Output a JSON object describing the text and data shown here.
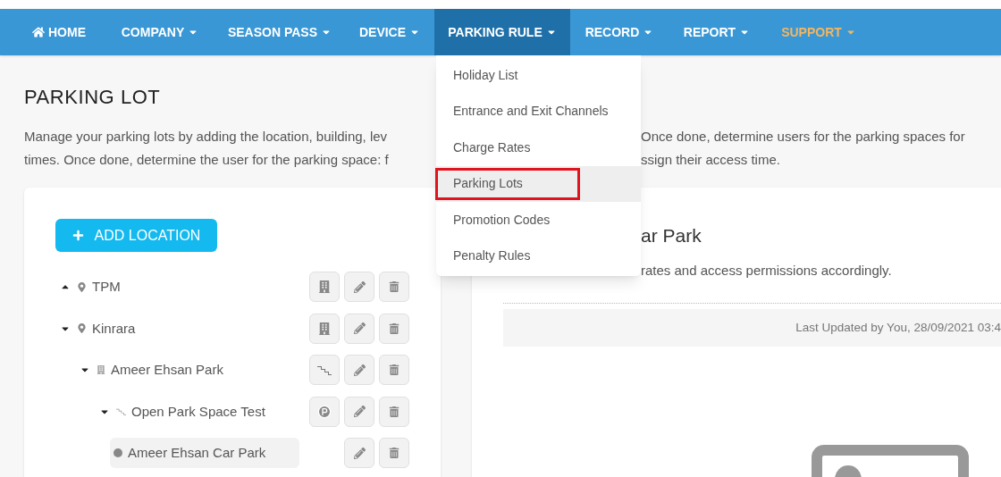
{
  "nav": [
    {
      "label": "HOME",
      "kind": "home",
      "selected": false,
      "highlight": false
    },
    {
      "label": "COMPANY",
      "kind": "menu",
      "selected": false,
      "highlight": false
    },
    {
      "label": "SEASON PASS",
      "kind": "menu",
      "selected": false,
      "highlight": false
    },
    {
      "label": "DEVICE",
      "kind": "menu",
      "selected": false,
      "highlight": false
    },
    {
      "label": "PARKING RULE",
      "kind": "menu",
      "selected": true,
      "highlight": false
    },
    {
      "label": "RECORD",
      "kind": "menu",
      "selected": false,
      "highlight": false
    },
    {
      "label": "REPORT",
      "kind": "menu",
      "selected": false,
      "highlight": false
    },
    {
      "label": "SUPPORT",
      "kind": "menu",
      "selected": false,
      "highlight": true
    }
  ],
  "dropdown": [
    {
      "label": "Holiday List",
      "selected": false,
      "highlighted": false
    },
    {
      "label": "Entrance and Exit Channels",
      "selected": false,
      "highlighted": false
    },
    {
      "label": "Charge Rates",
      "selected": false,
      "highlighted": false
    },
    {
      "label": "Parking Lots",
      "selected": true,
      "highlighted": true
    },
    {
      "label": "Promotion Codes",
      "selected": false,
      "highlighted": false
    },
    {
      "label": "Penalty Rules",
      "selected": false,
      "highlighted": false
    }
  ],
  "page_title": "PARKING LOT",
  "description_lines": [
    {
      "left": "Manage your parking lots by adding the location, building, lev",
      "right": "Once done, determine users for the parking spaces for"
    },
    {
      "left": "times. Once done, determine the user for the parking space: f",
      "right": "ssign their access time."
    }
  ],
  "add_button": {
    "label": "ADD LOCATION"
  },
  "tree": [
    {
      "name": "TPM",
      "kind": "location",
      "expanded": false,
      "selected": false
    },
    {
      "name": "Kinrara",
      "kind": "location",
      "expanded": true,
      "selected": false,
      "children": [
        {
          "name": "Ameer Ehsan Park",
          "kind": "building",
          "expanded": true,
          "selected": false,
          "children": [
            {
              "name": "Open Park Space Test",
              "kind": "level",
              "expanded": true,
              "selected": false,
              "children": [
                {
                  "name": "Ameer Ehsan Car Park",
                  "kind": "space",
                  "selected": true
                }
              ]
            }
          ]
        }
      ]
    }
  ],
  "detail": {
    "title": "ar Park",
    "subtitle": "rates and access permissions accordingly.",
    "updated": "Last Updated by You, 28/09/2021 03:4"
  }
}
